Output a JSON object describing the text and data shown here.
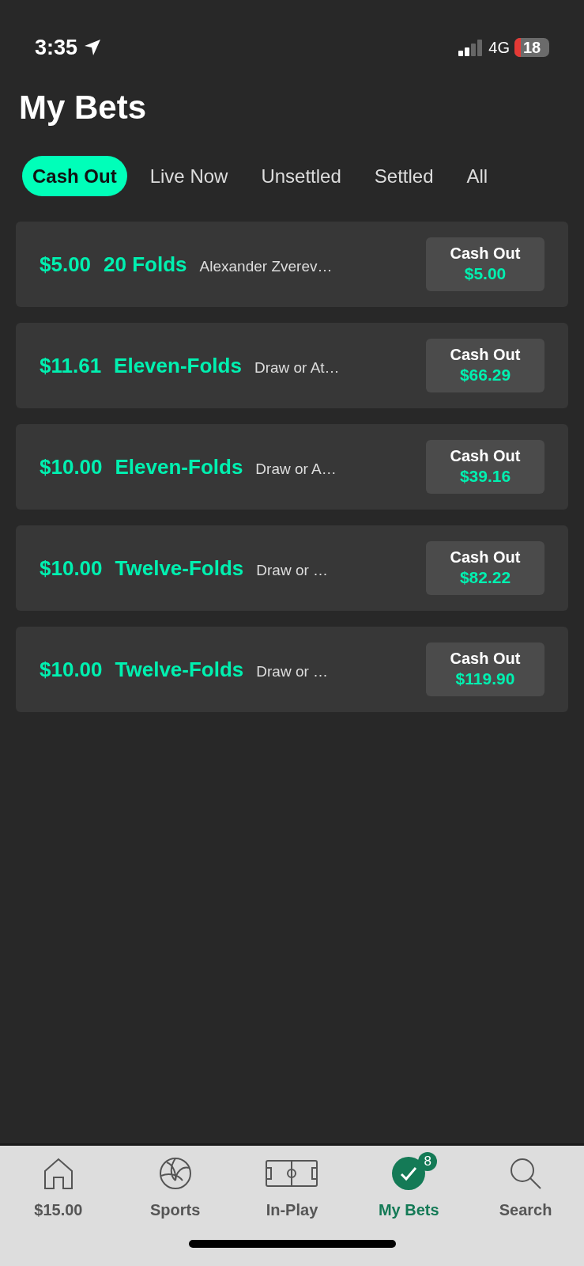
{
  "status_bar": {
    "time": "3:35",
    "network": "4G",
    "battery": "18"
  },
  "title": "My Bets",
  "tabs": [
    {
      "label": "Cash Out",
      "selected": true
    },
    {
      "label": "Live Now",
      "selected": false
    },
    {
      "label": "Unsettled",
      "selected": false
    },
    {
      "label": "Settled",
      "selected": false
    },
    {
      "label": "All",
      "selected": false
    }
  ],
  "bets": [
    {
      "stake": "$5.00",
      "type": "20 Folds",
      "description": "Alexander Zverev…",
      "cash_out_label": "Cash Out",
      "cash_out_amount": "$5.00"
    },
    {
      "stake": "$11.61",
      "type": "Eleven-Folds",
      "description": "Draw or At…",
      "cash_out_label": "Cash Out",
      "cash_out_amount": "$66.29"
    },
    {
      "stake": "$10.00",
      "type": "Eleven-Folds",
      "description": "Draw or A…",
      "cash_out_label": "Cash Out",
      "cash_out_amount": "$39.16"
    },
    {
      "stake": "$10.00",
      "type": "Twelve-Folds",
      "description": "Draw or …",
      "cash_out_label": "Cash Out",
      "cash_out_amount": "$82.22"
    },
    {
      "stake": "$10.00",
      "type": "Twelve-Folds",
      "description": "Draw or …",
      "cash_out_label": "Cash Out",
      "cash_out_amount": "$119.90"
    }
  ],
  "nav": [
    {
      "kind": "home",
      "label": "$15.00",
      "selected": false
    },
    {
      "kind": "sports",
      "label": "Sports",
      "selected": false
    },
    {
      "kind": "inplay",
      "label": "In-Play",
      "selected": false
    },
    {
      "kind": "mybets",
      "label": "My Bets",
      "selected": true,
      "badge": "8"
    },
    {
      "kind": "search",
      "label": "Search",
      "selected": false
    }
  ]
}
